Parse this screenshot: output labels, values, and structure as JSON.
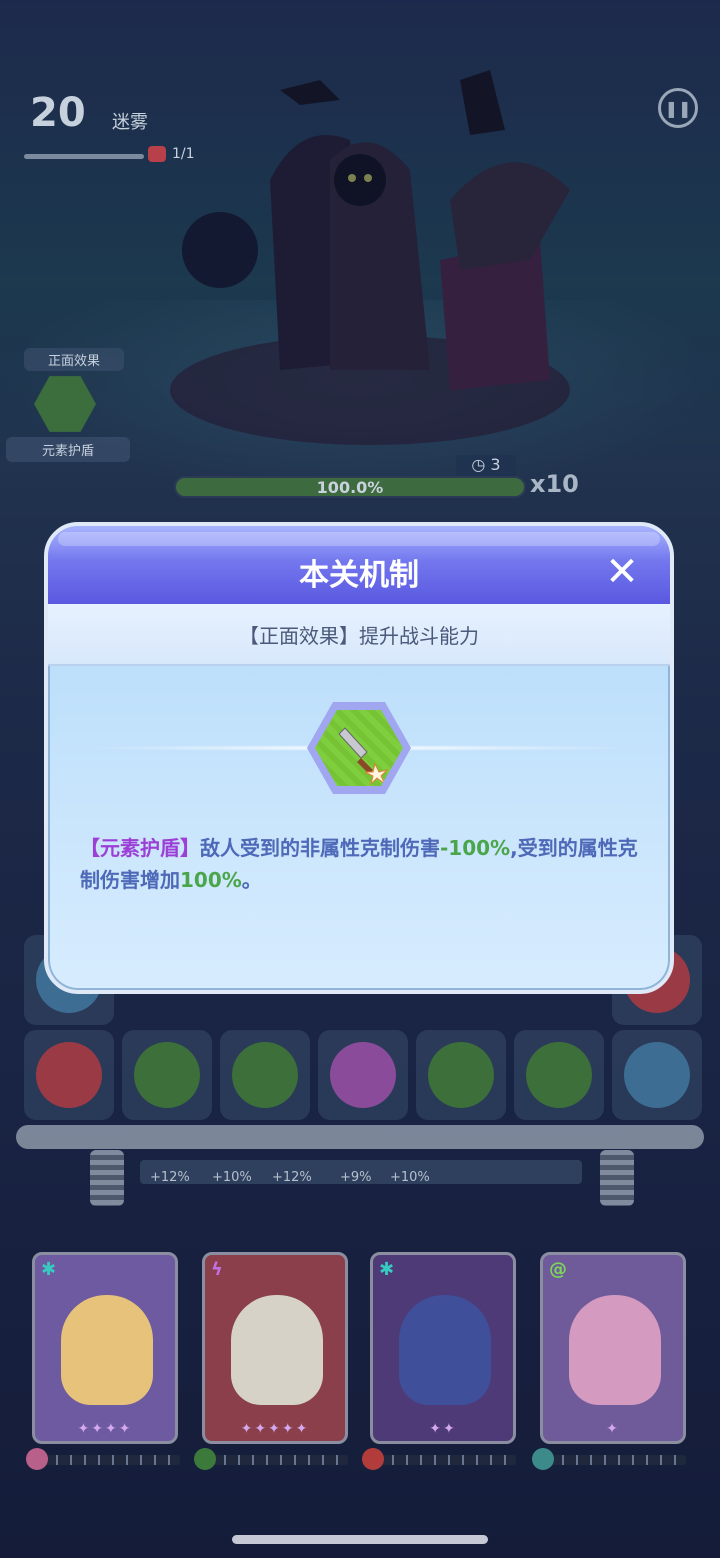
{
  "level": {
    "number": "20",
    "name": "迷雾",
    "wave": "1/1"
  },
  "effect_panel": {
    "title": "正面效果",
    "label": "元素护盾"
  },
  "boss": {
    "timer": "3",
    "hp": "100.0%",
    "multiplier": "x10"
  },
  "buffs": [
    "+12%",
    "+10%",
    "+12%",
    "+9%",
    "+10%"
  ],
  "heroes": [
    {
      "element_icon": "snowflake-icon",
      "stars": "✦✦✦✦",
      "color": "#8a74c8"
    },
    {
      "element_icon": "lightning-icon",
      "stars": "✦✦✦✦✦",
      "color": "#b9535a"
    },
    {
      "element_icon": "snowflake-icon",
      "stars": "✦✦",
      "color": "#7a4a9a"
    },
    {
      "element_icon": "spiral-icon",
      "stars": "✦",
      "color": "#8e6ab2"
    }
  ],
  "modal": {
    "title": "本关机制",
    "close_icon": "close-icon",
    "subtitle": "【正面效果】提升战斗能力",
    "item_icon": "element-shield-icon",
    "description": {
      "tag": "【元素护盾】",
      "text1": "敌人受到的非属性克制伤害",
      "num1": "-100%",
      "text2": ",受到的属性克制伤害增加",
      "num2": "100%",
      "text3": "。"
    }
  }
}
